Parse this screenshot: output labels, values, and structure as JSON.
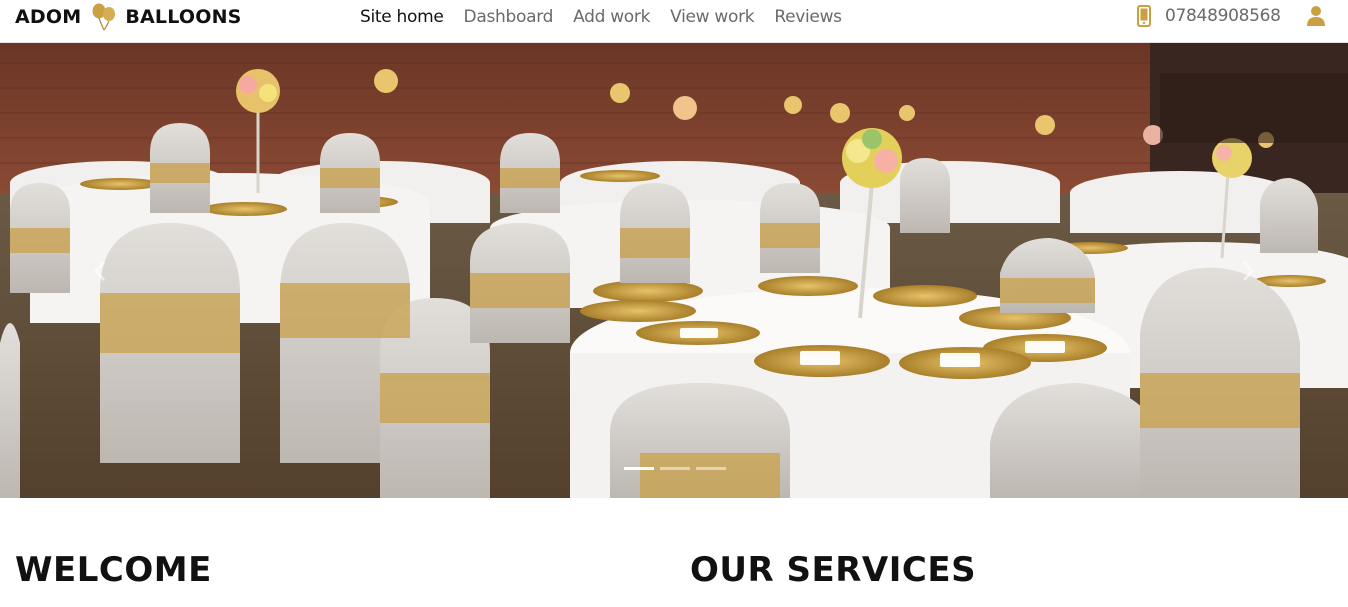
{
  "brand": {
    "left": "ADOM",
    "right": "BALLOONS",
    "balloon_color": "#c9a042"
  },
  "nav": {
    "items": [
      {
        "label": "Site home",
        "active": true
      },
      {
        "label": "Dashboard",
        "active": false
      },
      {
        "label": "Add work",
        "active": false
      },
      {
        "label": "View work",
        "active": false
      },
      {
        "label": "Reviews",
        "active": false
      }
    ]
  },
  "contact": {
    "phone": "07848908568",
    "icon": "mobile-phone-icon",
    "accent": "#c9a042"
  },
  "user": {
    "icon": "user-icon"
  },
  "carousel": {
    "slide_count": 3,
    "active_index": 0,
    "prev_icon": "chevron-left-icon",
    "next_icon": "chevron-right-icon"
  },
  "sections": {
    "welcome": "WELCOME",
    "services": "OUR SERVICES"
  }
}
